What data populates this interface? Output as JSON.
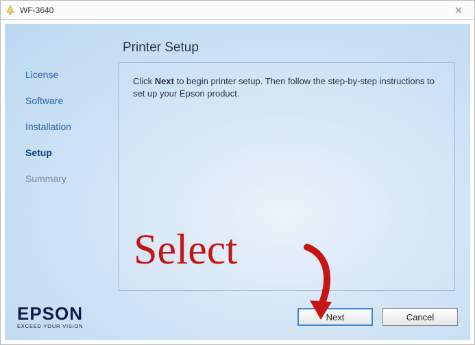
{
  "window": {
    "title": "WF-3640"
  },
  "sidebar": {
    "steps": [
      {
        "label": "License"
      },
      {
        "label": "Software"
      },
      {
        "label": "Installation"
      },
      {
        "label": "Setup"
      },
      {
        "label": "Summary"
      }
    ]
  },
  "main": {
    "heading": "Printer Setup",
    "instruction_prefix": "Click ",
    "instruction_bold": "Next",
    "instruction_suffix": " to begin printer setup. Then follow the step-by-step instructions to set up your Epson product."
  },
  "footer": {
    "brand": "EPSON",
    "tagline": "EXCEED YOUR VISION",
    "next_label": "Next",
    "cancel_label": "Cancel"
  },
  "annotation": {
    "text": "Select"
  }
}
